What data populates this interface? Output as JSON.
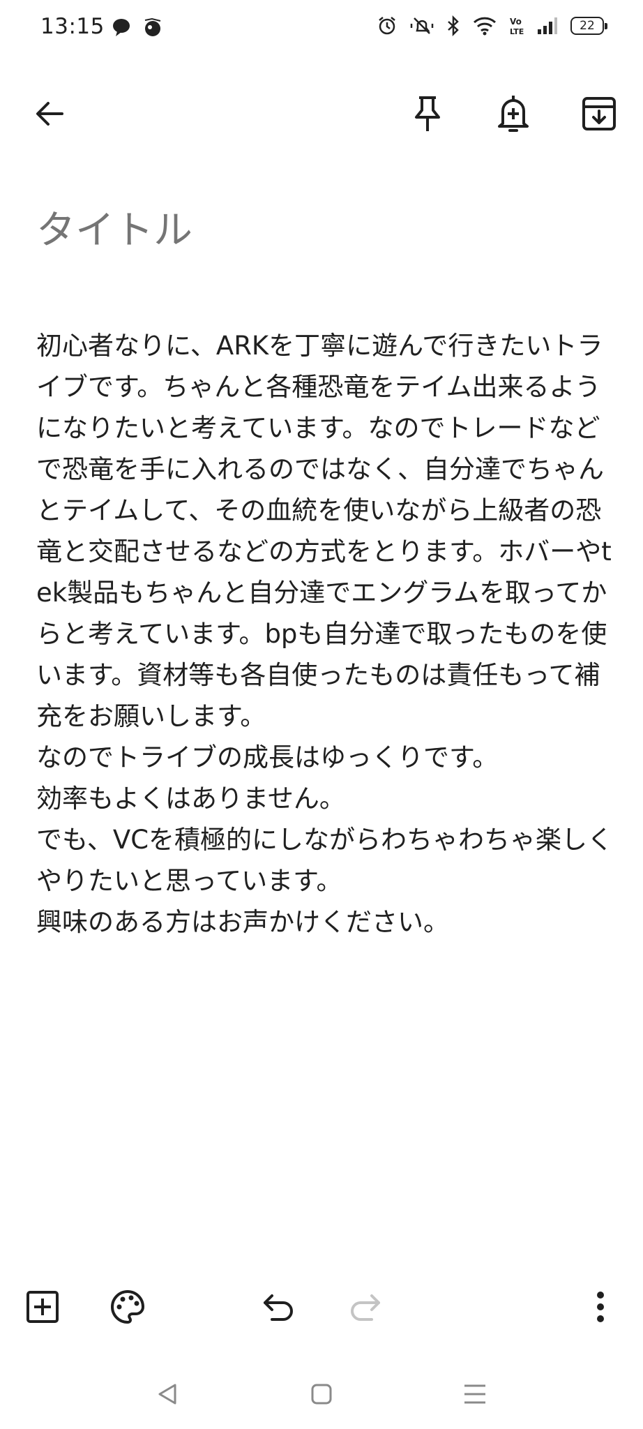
{
  "status_bar": {
    "time": "13:15",
    "battery": "22",
    "left_icons": [
      "chat-bubble-icon",
      "app-notification-icon"
    ],
    "right_icons": [
      "alarm-icon",
      "mute-icon",
      "bluetooth-icon",
      "wifi-icon",
      "volte-icon",
      "signal-icon",
      "battery-icon"
    ]
  },
  "top_toolbar": {
    "back_icon": "arrow-left-icon",
    "pin_icon": "pin-icon",
    "reminder_icon": "bell-plus-icon",
    "archive_icon": "archive-icon"
  },
  "note": {
    "title_placeholder": "タイトル",
    "title_value": "",
    "body": "初心者なりに、ARKを丁寧に遊んで行きたいトライブです。ちゃんと各種恐竜をテイム出来るようになりたいと考えています。なのでトレードなどで恐竜を手に入れるのではなく、自分達でちゃんとテイムして、その血統を使いながら上級者の恐竜と交配させるなどの方式をとります。ホバーやtek製品もちゃんと自分達でエングラムを取ってからと考えています。bpも自分達で取ったものを使います。資材等も各自使ったものは責任もって補充をお願いします。\nなのでトライブの成長はゆっくりです。\n効率もよくはありません。\nでも、VCを積極的にしながらわちゃわちゃ楽しくやりたいと思っています。\n興味のある方はお声かけください。"
  },
  "bottom_toolbar": {
    "add_icon": "add-box-icon",
    "palette_icon": "palette-icon",
    "undo_icon": "undo-icon",
    "redo_icon": "redo-icon",
    "more_icon": "more-vert-icon"
  },
  "nav_bar": {
    "back": "nav-back-icon",
    "home": "nav-home-icon",
    "recents": "nav-recents-icon"
  },
  "colors": {
    "background": "#ffffff",
    "text": "#202020",
    "placeholder": "#9e9e9e",
    "disabled_icon": "#c4c4c4"
  }
}
